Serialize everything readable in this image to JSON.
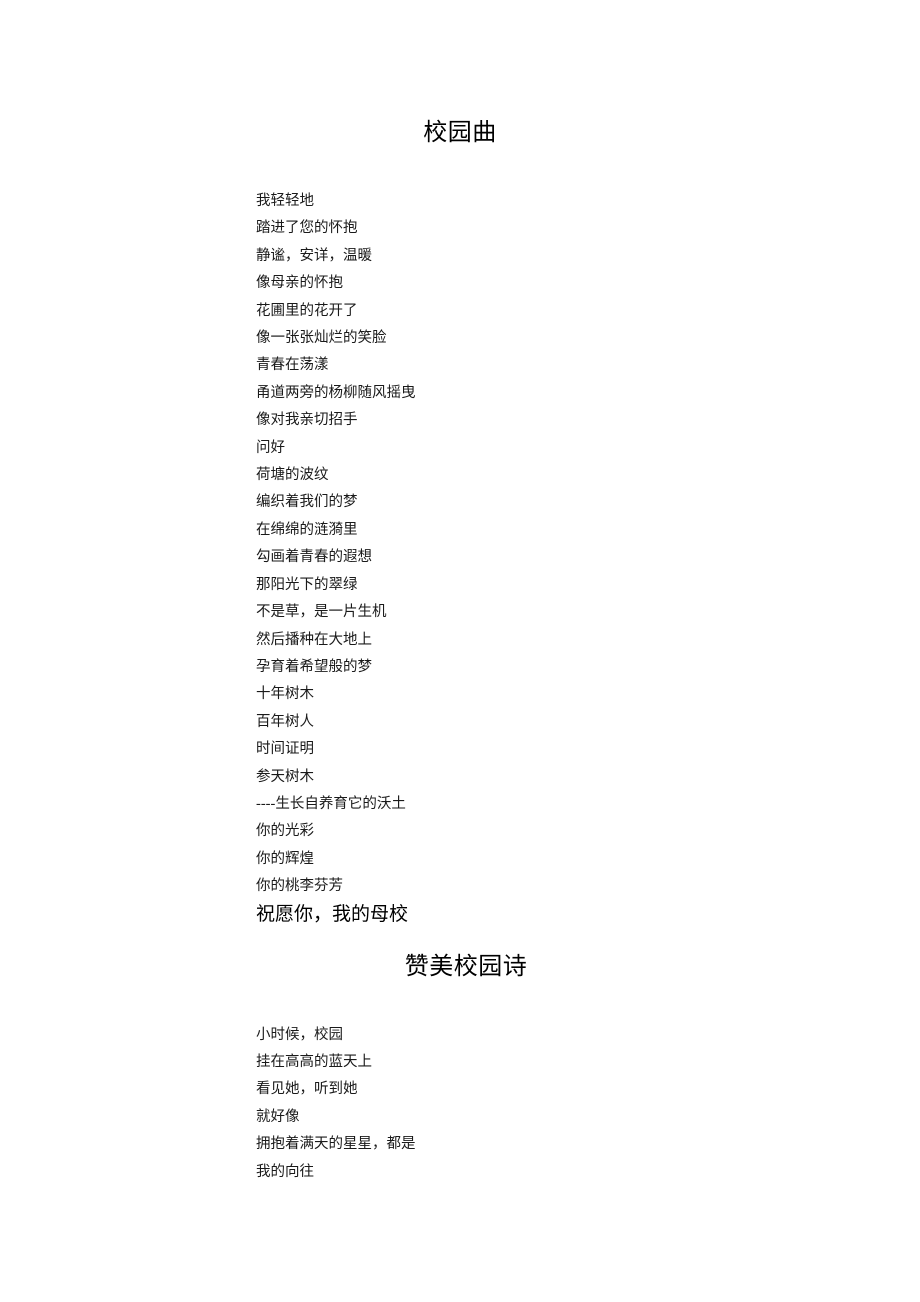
{
  "document": {
    "sections": [
      {
        "id": "section-xiaoyuanqu",
        "title": "校园曲",
        "lines": [
          {
            "text": "我轻轻地",
            "emphasis": false
          },
          {
            "text": "踏进了您的怀抱",
            "emphasis": false
          },
          {
            "text": "静谧，安详，温暖",
            "emphasis": false
          },
          {
            "text": "像母亲的怀抱",
            "emphasis": false
          },
          {
            "text": "花圃里的花开了",
            "emphasis": false
          },
          {
            "text": "像一张张灿烂的笑脸",
            "emphasis": false
          },
          {
            "text": "青春在荡漾",
            "emphasis": false
          },
          {
            "text": "甬道两旁的杨柳随风摇曳",
            "emphasis": false
          },
          {
            "text": "像对我亲切招手",
            "emphasis": false
          },
          {
            "text": "问好",
            "emphasis": false
          },
          {
            "text": "荷塘的波纹",
            "emphasis": false
          },
          {
            "text": "编织着我们的梦",
            "emphasis": false
          },
          {
            "text": "在绵绵的涟漪里",
            "emphasis": false
          },
          {
            "text": "勾画着青春的遐想",
            "emphasis": false
          },
          {
            "text": "那阳光下的翠绿",
            "emphasis": false
          },
          {
            "text": "不是草，是一片生机",
            "emphasis": false
          },
          {
            "text": "然后播种在大地上",
            "emphasis": false
          },
          {
            "text": "孕育着希望般的梦",
            "emphasis": false
          },
          {
            "text": "十年树木",
            "emphasis": false
          },
          {
            "text": "百年树人",
            "emphasis": false
          },
          {
            "text": "时间证明",
            "emphasis": false
          },
          {
            "text": "参天树木",
            "emphasis": false
          },
          {
            "text": "----生长自养育它的沃土",
            "emphasis": false
          },
          {
            "text": "你的光彩",
            "emphasis": false
          },
          {
            "text": "你的辉煌",
            "emphasis": false
          },
          {
            "text": "你的桃李芬芳",
            "emphasis": false
          },
          {
            "text": "祝愿你，我的母校",
            "emphasis": true
          }
        ]
      },
      {
        "id": "section-zanmeixiaoyuanshi",
        "title": "赞美校园诗",
        "lines": [
          {
            "text": "小时候，校园",
            "emphasis": false
          },
          {
            "text": "挂在高高的蓝天上",
            "emphasis": false
          },
          {
            "text": "看见她，听到她",
            "emphasis": false
          },
          {
            "text": "就好像",
            "emphasis": false
          },
          {
            "text": "拥抱着满天的星星，都是",
            "emphasis": false
          },
          {
            "text": "我的向往",
            "emphasis": false
          }
        ]
      }
    ]
  }
}
